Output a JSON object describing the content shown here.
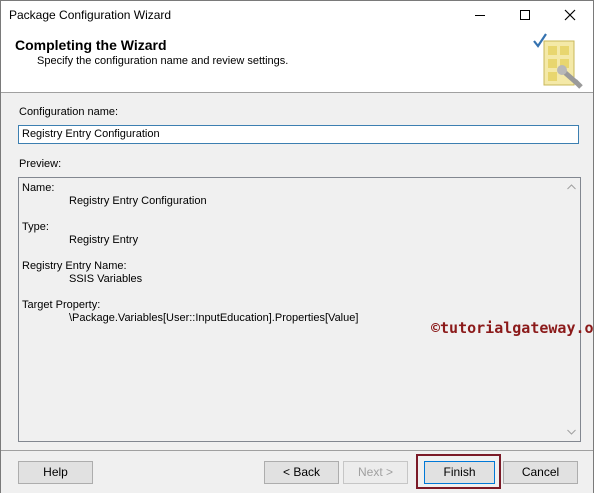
{
  "window": {
    "title": "Package Configuration Wizard"
  },
  "header": {
    "title": "Completing the Wizard",
    "subtitle": "Specify the configuration name and review settings."
  },
  "config_name": {
    "label": "Configuration name:",
    "value": "Registry Entry Configuration"
  },
  "preview": {
    "label": "Preview:",
    "entries": [
      {
        "label": "Name:",
        "value": "Registry Entry Configuration"
      },
      {
        "label": "Type:",
        "value": "Registry Entry"
      },
      {
        "label": "Registry Entry Name:",
        "value": "SSIS Variables"
      },
      {
        "label": "Target Property:",
        "value": "\\Package.Variables[User::InputEducation].Properties[Value]"
      }
    ]
  },
  "watermark": "©tutorialgateway.org",
  "buttons": {
    "help": "Help",
    "back": "< Back",
    "next": "Next >",
    "finish": "Finish",
    "cancel": "Cancel"
  },
  "colors": {
    "highlight_box": "#7b1a27",
    "watermark": "#8b1a1a",
    "input_border": "#3c7fb1"
  }
}
